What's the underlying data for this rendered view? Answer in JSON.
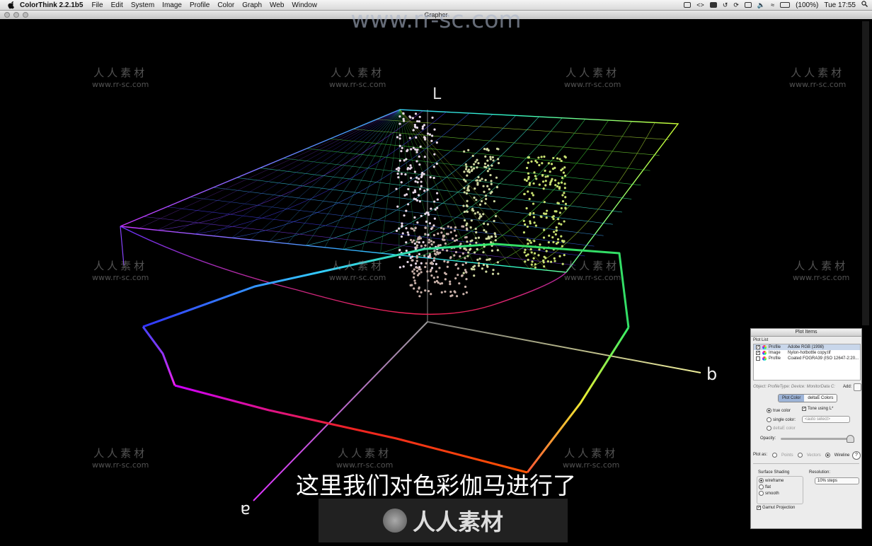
{
  "menubar": {
    "app_name": "ColorThink 2.2.1b5",
    "menus": [
      "File",
      "Edit",
      "System",
      "Image",
      "Profile",
      "Color",
      "Graph",
      "Web",
      "Window"
    ],
    "battery": "(100%)",
    "clock": "Tue 17:55"
  },
  "window": {
    "title": "Grapher"
  },
  "axes": {
    "l": "L",
    "b": "b",
    "a": "a"
  },
  "panel": {
    "title": "Plot Items",
    "plot_list_label": "Plot List",
    "items": [
      {
        "checked": true,
        "type": "Profile",
        "name": "Adobe RGB (1998)"
      },
      {
        "checked": true,
        "type": "Image",
        "name": "Nylon-hotbottle copy.tif"
      },
      {
        "checked": false,
        "type": "Profile",
        "name": "Coated FOGRA39 (ISO 12647-2:20..."
      }
    ],
    "object_line": "Object: ProfileType: Device: MonitorData C:",
    "add_label": "Add:",
    "tabs": [
      "Plot Color",
      "deltaE Colors"
    ],
    "true_color": "true color",
    "tone_using": "Tone using L*",
    "single_color": "single color:",
    "single_color_select": "<auto select>",
    "deltae_color": "deltaE color",
    "opacity_label": "Opacity:",
    "plot_as_label": "Plot as:",
    "plot_as_options": [
      "Points",
      "Vectors",
      "Wireline"
    ],
    "surface_shading_label": "Surface Shading",
    "shading_options": [
      "wireframe",
      "flat",
      "smooth"
    ],
    "resolution_label": "Resolution:",
    "resolution_value": "10% steps",
    "gamut_projection": "Gamut Projection"
  },
  "subtitle": "这里我们对色彩伽马进行了",
  "watermarks": {
    "top": "www.rr-sc.com",
    "cn": "人人素材",
    "en": "www.rr-sc.com",
    "logo_text": "人人素材"
  },
  "colors": {
    "background": "#000000",
    "panel": "#ececec"
  }
}
